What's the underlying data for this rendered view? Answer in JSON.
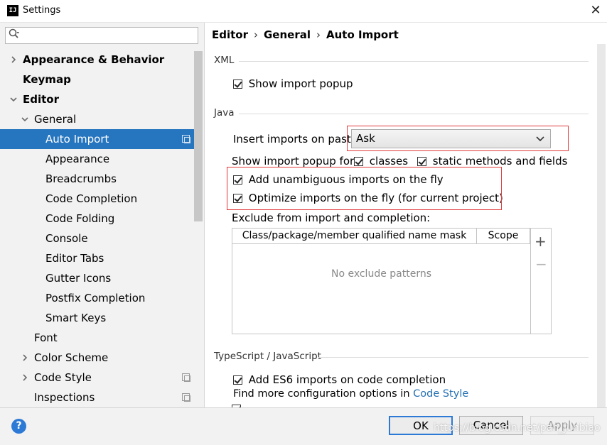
{
  "window": {
    "title": "Settings",
    "app_icon_text": "IJ"
  },
  "search": {
    "placeholder": ""
  },
  "tree": [
    {
      "label": "Appearance & Behavior",
      "level": 0,
      "arrow": "›",
      "bold": true
    },
    {
      "label": "Keymap",
      "level": 0,
      "arrow": "",
      "bold": true
    },
    {
      "label": "Editor",
      "level": 0,
      "arrow": "⌄",
      "bold": true
    },
    {
      "label": "General",
      "level": 1,
      "arrow": "⌄",
      "bold": false
    },
    {
      "label": "Auto Import",
      "level": 2,
      "arrow": "",
      "bold": false,
      "selected": true,
      "copy": true
    },
    {
      "label": "Appearance",
      "level": 2,
      "arrow": "",
      "bold": false
    },
    {
      "label": "Breadcrumbs",
      "level": 2,
      "arrow": "",
      "bold": false
    },
    {
      "label": "Code Completion",
      "level": 2,
      "arrow": "",
      "bold": false
    },
    {
      "label": "Code Folding",
      "level": 2,
      "arrow": "",
      "bold": false
    },
    {
      "label": "Console",
      "level": 2,
      "arrow": "",
      "bold": false
    },
    {
      "label": "Editor Tabs",
      "level": 2,
      "arrow": "",
      "bold": false
    },
    {
      "label": "Gutter Icons",
      "level": 2,
      "arrow": "",
      "bold": false
    },
    {
      "label": "Postfix Completion",
      "level": 2,
      "arrow": "",
      "bold": false
    },
    {
      "label": "Smart Keys",
      "level": 2,
      "arrow": "",
      "bold": false
    },
    {
      "label": "Font",
      "level": 1,
      "arrow": "",
      "bold": false
    },
    {
      "label": "Color Scheme",
      "level": 1,
      "arrow": "›",
      "bold": false
    },
    {
      "label": "Code Style",
      "level": 1,
      "arrow": "›",
      "bold": false,
      "copy": true
    },
    {
      "label": "Inspections",
      "level": 1,
      "arrow": "",
      "bold": false,
      "copy": true
    }
  ],
  "breadcrumb": {
    "items": [
      "Editor",
      "General",
      "Auto Import"
    ],
    "separator": "›"
  },
  "xml": {
    "title": "XML",
    "show_import_popup": {
      "label": "Show import popup",
      "checked": true
    }
  },
  "java": {
    "title": "Java",
    "insert_imports_label": "Insert imports on paste:",
    "insert_imports_value": "Ask",
    "show_popup_for_label": "Show import popup for:",
    "classes": {
      "label": "classes",
      "checked": true
    },
    "static_methods": {
      "label": "static methods and fields",
      "checked": true
    },
    "add_unambiguous": {
      "label": "Add unambiguous imports on the fly",
      "checked": true
    },
    "optimize_imports": {
      "label": "Optimize imports on the fly (for current project)",
      "checked": true
    },
    "exclude_label": "Exclude from import and completion:",
    "table": {
      "columns": [
        "Class/package/member qualified name mask",
        "Scope"
      ],
      "empty_text": "No exclude patterns",
      "add_label": "+",
      "remove_label": "−"
    }
  },
  "typescript": {
    "title": "TypeScript / JavaScript",
    "add_es6": {
      "label": "Add ES6 imports on code completion",
      "checked": true
    },
    "find_more_text": "Find more configuration options in ",
    "find_more_link": "Code Style"
  },
  "buttons": {
    "help": "?",
    "ok": "OK",
    "cancel": "Cancel",
    "apply": "Apply"
  },
  "watermark": "https://blog.csdn.net/pan_junbiao",
  "colors": {
    "selection": "#2675bf",
    "highlight_box": "#e03a3a",
    "link": "#2470b3"
  },
  "icons": {
    "close": "close-icon",
    "search": "search-icon",
    "help": "help-icon",
    "copy": "copy-icon"
  }
}
